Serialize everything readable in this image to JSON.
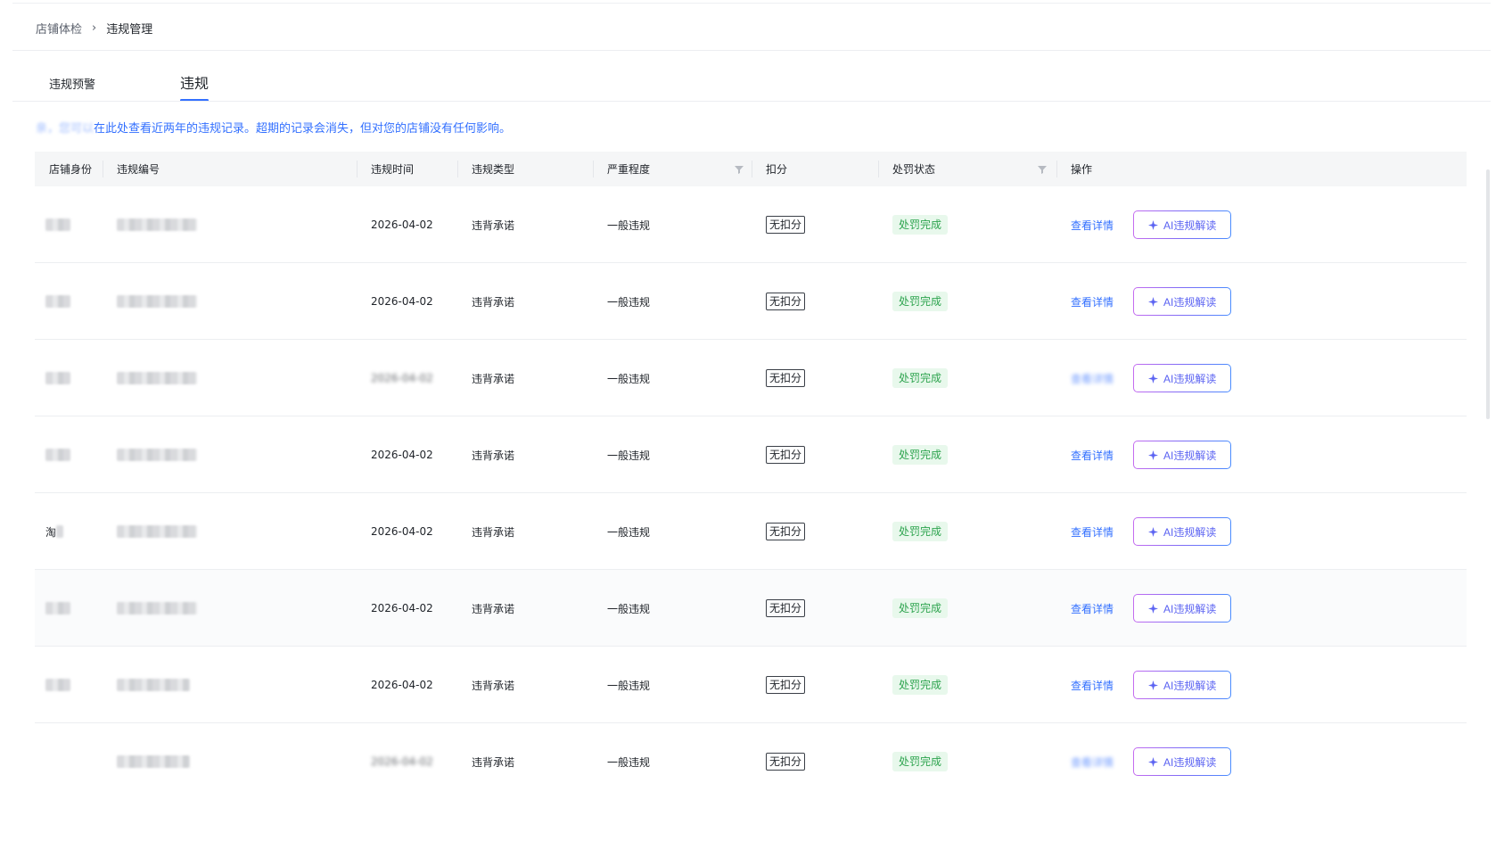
{
  "breadcrumb": {
    "parent": "店铺体检",
    "separator": "›",
    "current": "违规管理"
  },
  "tabs": [
    {
      "label": "违规预警",
      "active": false
    },
    {
      "label": "违规",
      "active": true
    }
  ],
  "notice": {
    "prefix": "亲，您可以",
    "text": "在此处查看近两年的违规记录。超期的记录会消失，但对您的店铺没有任何影响。"
  },
  "table": {
    "columns": [
      "店铺身份",
      "违规编号",
      "违规时间",
      "违规类型",
      "严重程度",
      "扣分",
      "处罚状态",
      "操作"
    ],
    "rows": [
      {
        "identity": "",
        "id": "",
        "time": "2026-04-02",
        "type": "违背承诺",
        "severity": "一般违规",
        "deduct": "无扣分",
        "status": "处罚完成",
        "detail": "查看详情",
        "ai": "AI违规解读"
      },
      {
        "identity": "",
        "id": "",
        "time": "2026-04-02",
        "type": "违背承诺",
        "severity": "一般违规",
        "deduct": "无扣分",
        "status": "处罚完成",
        "detail": "查看详情",
        "ai": "AI违规解读"
      },
      {
        "identity": "",
        "id": "",
        "time": "2026-04-02",
        "type": "违背承诺",
        "severity": "一般违规",
        "deduct": "无扣分",
        "status": "处罚完成",
        "detail": "查看详情",
        "ai": "AI违规解读"
      },
      {
        "identity": "",
        "id": "",
        "time": "2026-04-02",
        "type": "违背承诺",
        "severity": "一般违规",
        "deduct": "无扣分",
        "status": "处罚完成",
        "detail": "查看详情",
        "ai": "AI违规解读"
      },
      {
        "identity": "淘",
        "id": "",
        "time": "2026-04-02",
        "type": "违背承诺",
        "severity": "一般违规",
        "deduct": "无扣分",
        "status": "处罚完成",
        "detail": "查看详情",
        "ai": "AI违规解读"
      },
      {
        "identity": "",
        "id": "",
        "time": "2026-04-02",
        "type": "违背承诺",
        "severity": "一般违规",
        "deduct": "无扣分",
        "status": "处罚完成",
        "detail": "查看详情",
        "ai": "AI违规解读"
      },
      {
        "identity": "",
        "id": "",
        "time": "2026-04-02",
        "type": "违背承诺",
        "severity": "一般违规",
        "deduct": "无扣分",
        "status": "处罚完成",
        "detail": "查看详情",
        "ai": "AI违规解读"
      },
      {
        "identity": "",
        "id": "",
        "time": "2026-04-02",
        "type": "违背承诺",
        "severity": "一般违规",
        "deduct": "无扣分",
        "status": "处罚完成",
        "detail": "查看详情",
        "ai": "AI违规解读"
      }
    ]
  },
  "colors": {
    "accent": "#3370ff",
    "success": "#2ea44f",
    "success_bg": "#e8f8ec",
    "header_bg": "#f5f6f7"
  },
  "icons": {
    "filter": "filter-icon",
    "sparkle": "sparkle-icon",
    "chevron": "chevron-right-icon"
  }
}
